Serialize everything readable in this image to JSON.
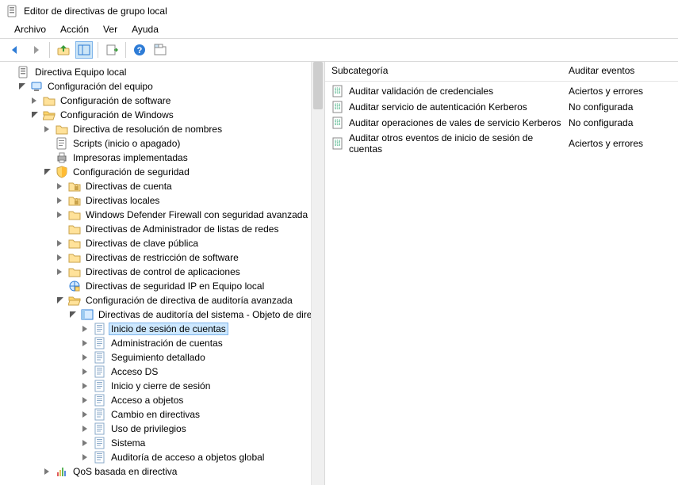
{
  "title": "Editor de directivas de grupo local",
  "menu": {
    "archivo": "Archivo",
    "accion": "Acción",
    "ver": "Ver",
    "ayuda": "Ayuda"
  },
  "tree": {
    "root": "Directiva Equipo local",
    "config_equipo": "Configuración del equipo",
    "config_software": "Configuración de software",
    "config_windows": "Configuración de Windows",
    "res_nombres": "Directiva de resolución de nombres",
    "scripts": "Scripts (inicio o apagado)",
    "impresoras": "Impresoras implementadas",
    "config_seg": "Configuración de seguridad",
    "dir_cuenta": "Directivas de cuenta",
    "dir_locales": "Directivas locales",
    "defender": "Windows Defender Firewall con seguridad avanzada",
    "admin_listas": "Directivas de Administrador de listas de redes",
    "clave_publica": "Directivas de clave pública",
    "restr_software": "Directivas de restricción de software",
    "control_apps": "Directivas de control de aplicaciones",
    "seg_ip": "Directivas de seguridad IP en Equipo local",
    "audit_avanzada": "Configuración de directiva de auditoría avanzada",
    "audit_sistema": "Directivas de auditoría del sistema - Objeto de direc",
    "inicio_sesion_cuentas": "Inicio de sesión de cuentas",
    "admin_cuentas": "Administración de cuentas",
    "seguimiento": "Seguimiento detallado",
    "acceso_ds": "Acceso DS",
    "inicio_cierre": "Inicio y cierre de sesión",
    "acceso_objetos": "Acceso a objetos",
    "cambio_dir": "Cambio en directivas",
    "uso_priv": "Uso de privilegios",
    "sistema": "Sistema",
    "audit_global": "Auditoría de acceso a objetos global",
    "qos": "QoS basada en directiva"
  },
  "list": {
    "header_sub": "Subcategoría",
    "header_aud": "Auditar eventos",
    "rows": [
      {
        "name": "Auditar validación de credenciales",
        "value": "Aciertos y errores"
      },
      {
        "name": "Auditar servicio de autenticación Kerberos",
        "value": "No configurada"
      },
      {
        "name": "Auditar operaciones de vales de servicio Kerberos",
        "value": "No configurada"
      },
      {
        "name": "Auditar otros eventos de inicio de sesión de cuentas",
        "value": "Aciertos y errores"
      }
    ]
  }
}
